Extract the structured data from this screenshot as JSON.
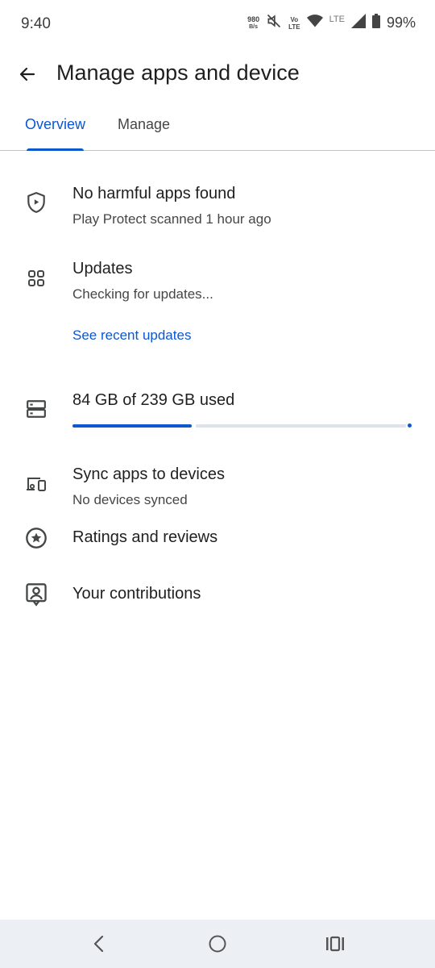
{
  "status_bar": {
    "time": "9:40",
    "net_speed_value": "980",
    "net_speed_unit": "B/s",
    "volte_top": "Vo",
    "volte_bottom": "LTE",
    "lte": "LTE",
    "battery": "99%",
    "icons": [
      "network-speed-icon",
      "mute-icon",
      "volte-icon",
      "wifi-icon",
      "cellular-signal-icon",
      "battery-icon"
    ]
  },
  "header": {
    "title": "Manage apps and device",
    "back_icon": "arrow-back-icon"
  },
  "tabs": [
    {
      "label": "Overview",
      "active": true
    },
    {
      "label": "Manage",
      "active": false
    }
  ],
  "overview": {
    "protect": {
      "title": "No harmful apps found",
      "subtitle": "Play Protect scanned 1 hour ago",
      "icon": "shield-play-icon"
    },
    "updates": {
      "title": "Updates",
      "subtitle": "Checking for updates...",
      "link": "See recent updates",
      "icon": "apps-grid-icon"
    },
    "storage": {
      "title": "84 GB of 239 GB used",
      "used_gb": 84,
      "total_gb": 239,
      "icon": "storage-icon"
    },
    "sync": {
      "title": "Sync apps to devices",
      "subtitle": "No devices synced",
      "icon": "devices-icon"
    },
    "ratings": {
      "title": "Ratings and reviews",
      "icon": "star-circle-icon"
    },
    "contributions": {
      "title": "Your contributions",
      "icon": "contributions-icon"
    }
  },
  "colors": {
    "accent": "#0b57d0",
    "track": "#dde3ea",
    "text": "#1f1f1f",
    "secondary": "#444746",
    "nav_bg": "#eceff3"
  },
  "nav_bar": {
    "icons": [
      "nav-back-icon",
      "nav-home-icon",
      "nav-recents-icon"
    ]
  }
}
